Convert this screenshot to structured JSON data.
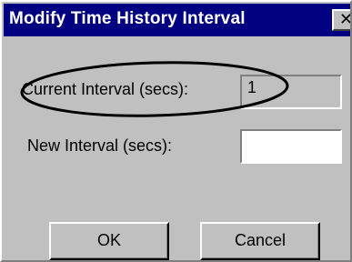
{
  "dialog": {
    "title": "Modify Time History Interval",
    "close_glyph": "✕"
  },
  "form": {
    "current_label": "Current Interval (secs):",
    "current_value": "1",
    "new_label": "New Interval (secs):",
    "new_value": ""
  },
  "buttons": {
    "ok_label": "OK",
    "cancel_label": "Cancel"
  },
  "annotation": {
    "stroke_color": "#000000"
  }
}
